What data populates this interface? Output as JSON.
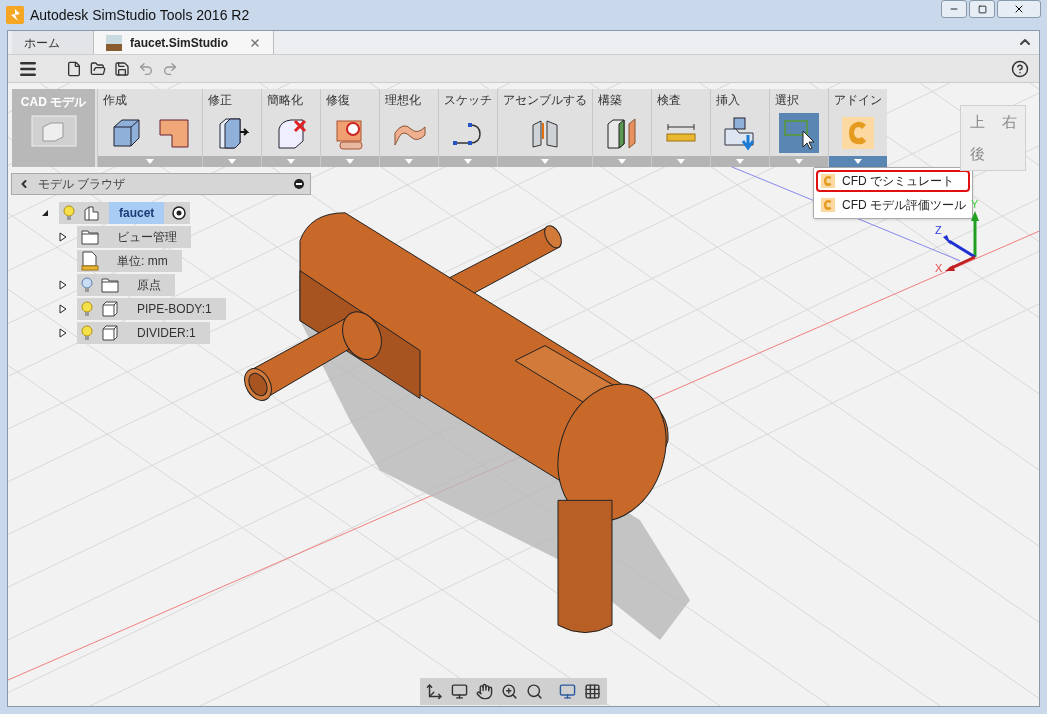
{
  "window": {
    "title": "Autodesk SimStudio Tools 2016 R2"
  },
  "tabs": [
    {
      "label": "ホーム",
      "kind": "home",
      "selected": false
    },
    {
      "label": "faucet.SimStudio",
      "kind": "document",
      "selected": true
    }
  ],
  "workspace": {
    "label": "CAD モデル"
  },
  "ribbon": [
    {
      "label": "作成",
      "open": false,
      "tools": [
        {
          "kind": "box",
          "selected": false
        },
        {
          "kind": "lshape",
          "selected": false
        }
      ]
    },
    {
      "label": "修正",
      "open": false,
      "tools": [
        {
          "kind": "pushpull",
          "selected": false
        }
      ]
    },
    {
      "label": "簡略化",
      "open": false,
      "tools": [
        {
          "kind": "simplify",
          "selected": false
        }
      ]
    },
    {
      "label": "修復",
      "open": false,
      "tools": [
        {
          "kind": "repair",
          "selected": false
        }
      ]
    },
    {
      "label": "理想化",
      "open": false,
      "tools": [
        {
          "kind": "idealize",
          "selected": false
        }
      ]
    },
    {
      "label": "スケッチ",
      "open": false,
      "tools": [
        {
          "kind": "sketch",
          "selected": false
        }
      ]
    },
    {
      "label": "アセンブルする",
      "open": false,
      "tools": [
        {
          "kind": "assemble",
          "selected": false
        }
      ]
    },
    {
      "label": "構築",
      "open": false,
      "tools": [
        {
          "kind": "construct",
          "selected": false
        }
      ]
    },
    {
      "label": "検査",
      "open": false,
      "tools": [
        {
          "kind": "measure",
          "selected": false
        }
      ]
    },
    {
      "label": "挿入",
      "open": false,
      "tools": [
        {
          "kind": "insert",
          "selected": false
        }
      ]
    },
    {
      "label": "選択",
      "open": false,
      "tools": [
        {
          "kind": "select",
          "selected": true
        }
      ]
    },
    {
      "label": "アドイン",
      "open": true,
      "tools": [
        {
          "kind": "addin",
          "selected": false
        }
      ]
    }
  ],
  "browser": {
    "title": "モデル ブラウザ",
    "tree": [
      {
        "label": "faucet",
        "kind": "component",
        "expanded": true,
        "visible": true,
        "selected": true,
        "active": true,
        "children": [
          {
            "label": "ビュー管理",
            "kind": "folder",
            "expanded": false,
            "selected": false
          },
          {
            "label": "単位: mm",
            "kind": "units",
            "selected": false
          },
          {
            "label": "原点",
            "kind": "folder",
            "expanded": false,
            "visible": false,
            "selected": false
          },
          {
            "label": "PIPE-BODY:1",
            "kind": "body",
            "expanded": false,
            "visible": true,
            "selected": false
          },
          {
            "label": "DIVIDER:1",
            "kind": "body",
            "expanded": false,
            "visible": true,
            "selected": false
          }
        ]
      }
    ]
  },
  "addin_menu": [
    {
      "label": "CFD でシミュレート",
      "highlighted": true
    },
    {
      "label": "CFD モデル評価ツール",
      "highlighted": false
    }
  ],
  "viewcube": {
    "faces": [
      "上",
      "右",
      "後"
    ]
  },
  "axes": [
    "X",
    "Y",
    "Z"
  ]
}
